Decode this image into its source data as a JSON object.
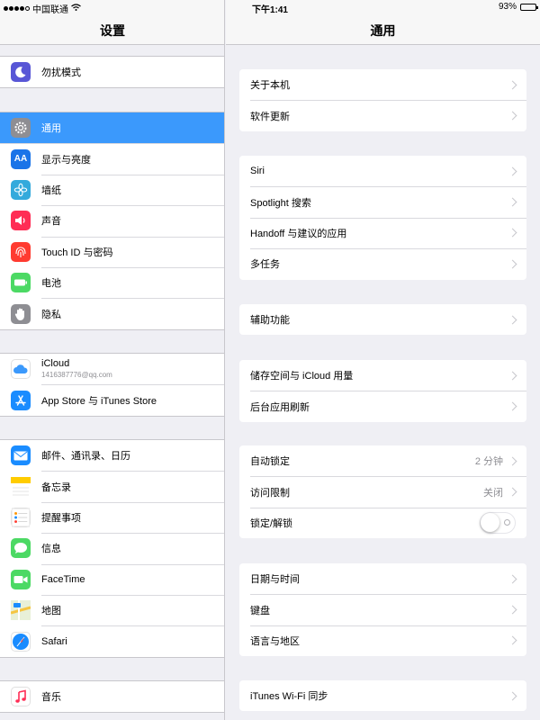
{
  "status": {
    "carrier": "中国联通",
    "time": "下午1:41",
    "battery": "93%",
    "battery_level": 0.93
  },
  "sidebar": {
    "title": "设置",
    "groups": [
      [
        {
          "label": "勿扰模式",
          "icon": "moon-icon",
          "color": "#5856d6"
        }
      ],
      [
        {
          "label": "通用",
          "icon": "gear-icon",
          "color": "#8e8e93",
          "selected": true
        },
        {
          "label": "显示与亮度",
          "icon": "text-size-icon",
          "color": "#1a74e8"
        },
        {
          "label": "墙纸",
          "icon": "flower-icon",
          "color": "#34aadc"
        },
        {
          "label": "声音",
          "icon": "speaker-icon",
          "color": "#ff2d55"
        },
        {
          "label": "Touch ID 与密码",
          "icon": "fingerprint-icon",
          "color": "#ff3b30"
        },
        {
          "label": "电池",
          "icon": "battery-icon",
          "color": "#4cd964"
        },
        {
          "label": "隐私",
          "icon": "hand-icon",
          "color": "#8e8e93"
        }
      ],
      [
        {
          "label": "iCloud",
          "sub": "1416387776@qq.com",
          "icon": "cloud-icon",
          "color": "#ffffff"
        },
        {
          "label": "App Store 与 iTunes Store",
          "icon": "app-store-icon",
          "color": "#1a8cff"
        }
      ],
      [
        {
          "label": "邮件、通讯录、日历",
          "icon": "mail-icon",
          "color": "#1a8cff"
        },
        {
          "label": "备忘录",
          "icon": "notes-icon",
          "color": "#ffcc00"
        },
        {
          "label": "提醒事项",
          "icon": "reminders-icon",
          "color": "#ffffff"
        },
        {
          "label": "信息",
          "icon": "message-icon",
          "color": "#4cd964"
        },
        {
          "label": "FaceTime",
          "icon": "facetime-icon",
          "color": "#4cd964"
        },
        {
          "label": "地图",
          "icon": "maps-icon",
          "color": "#e8f0d8"
        },
        {
          "label": "Safari",
          "icon": "compass-icon",
          "color": "#ffffff"
        }
      ],
      [
        {
          "label": "音乐",
          "icon": "music-icon",
          "color": "#ffffff"
        }
      ]
    ]
  },
  "detail": {
    "title": "通用",
    "groups": [
      [
        {
          "label": "关于本机"
        },
        {
          "label": "软件更新"
        }
      ],
      [
        {
          "label": "Siri"
        },
        {
          "label": "Spotlight 搜索"
        },
        {
          "label": "Handoff 与建议的应用"
        },
        {
          "label": "多任务"
        }
      ],
      [
        {
          "label": "辅助功能"
        }
      ],
      [
        {
          "label": "储存空间与 iCloud 用量"
        },
        {
          "label": "后台应用刷新"
        }
      ],
      [
        {
          "label": "自动锁定",
          "value": "2 分钟"
        },
        {
          "label": "访问限制",
          "value": "关闭"
        },
        {
          "label": "锁定/解锁",
          "toggle": false
        }
      ],
      [
        {
          "label": "日期与时间"
        },
        {
          "label": "键盘"
        },
        {
          "label": "语言与地区"
        }
      ],
      [
        {
          "label": "iTunes Wi-Fi 同步"
        }
      ]
    ]
  }
}
